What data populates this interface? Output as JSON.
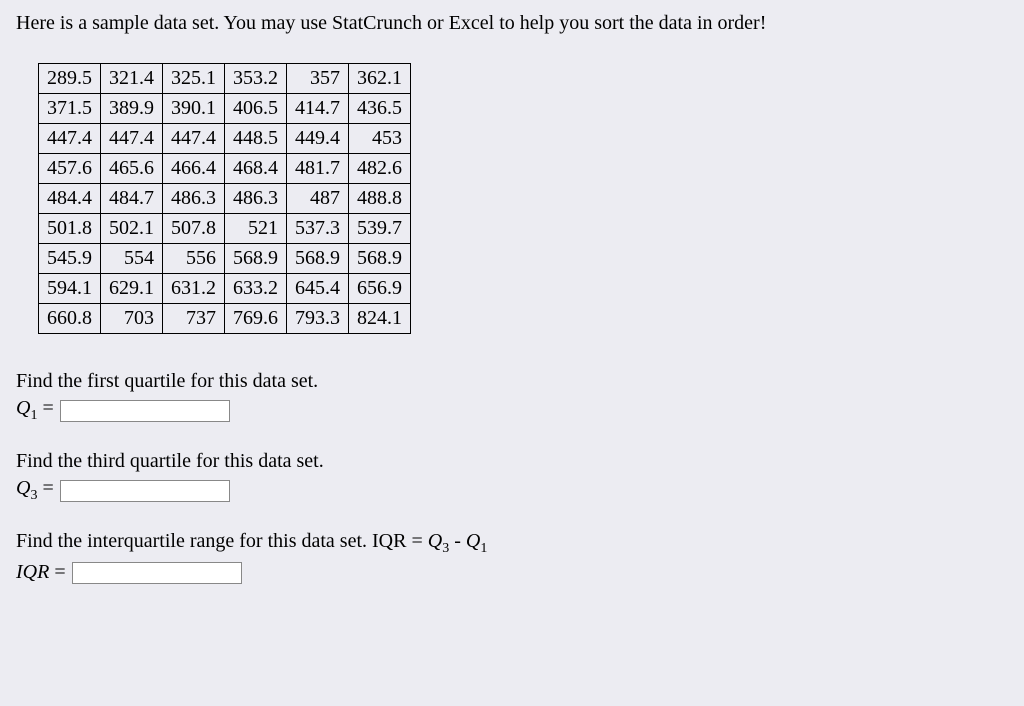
{
  "intro": "Here is a sample data set. You may use StatCrunch or Excel to help you sort the data in order!",
  "data_rows": [
    [
      "289.5",
      "321.4",
      "325.1",
      "353.2",
      "357",
      "362.1"
    ],
    [
      "371.5",
      "389.9",
      "390.1",
      "406.5",
      "414.7",
      "436.5"
    ],
    [
      "447.4",
      "447.4",
      "447.4",
      "448.5",
      "449.4",
      "453"
    ],
    [
      "457.6",
      "465.6",
      "466.4",
      "468.4",
      "481.7",
      "482.6"
    ],
    [
      "484.4",
      "484.7",
      "486.3",
      "486.3",
      "487",
      "488.8"
    ],
    [
      "501.8",
      "502.1",
      "507.8",
      "521",
      "537.3",
      "539.7"
    ],
    [
      "545.9",
      "554",
      "556",
      "568.9",
      "568.9",
      "568.9"
    ],
    [
      "594.1",
      "629.1",
      "631.2",
      "633.2",
      "645.4",
      "656.9"
    ],
    [
      "660.8",
      "703",
      "737",
      "769.6",
      "793.3",
      "824.1"
    ]
  ],
  "q1": {
    "prompt": "Find the first quartile for this data set.",
    "var_letter": "Q",
    "var_sub": "1",
    "eq": "="
  },
  "q3": {
    "prompt": "Find the third quartile for this data set.",
    "var_letter": "Q",
    "var_sub": "3",
    "eq": "="
  },
  "iqr": {
    "prompt_prefix": "Find the interquartile range for this data set. IQR = ",
    "q3_letter": "Q",
    "q3_sub": "3",
    "minus": " - ",
    "q1_letter": "Q",
    "q1_sub": "1",
    "var_label": "IQR",
    "eq": "="
  }
}
